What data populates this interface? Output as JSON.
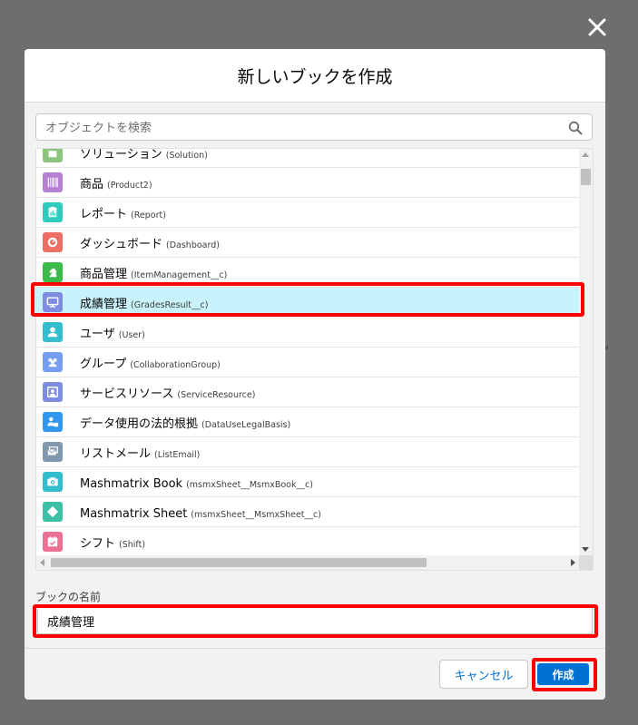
{
  "modal": {
    "title": "新しいブックを作成"
  },
  "search": {
    "placeholder": "オブジェクトを検索"
  },
  "objects": [
    {
      "label": "ソリューション",
      "api": "(Solution)",
      "icon": "solution-icon",
      "color": "#8dc47e"
    },
    {
      "label": "商品",
      "api": "(Product2)",
      "icon": "product-icon",
      "color": "#b781d3"
    },
    {
      "label": "レポート",
      "api": "(Report)",
      "icon": "report-icon",
      "color": "#2ecbbe"
    },
    {
      "label": "ダッシュボード",
      "api": "(Dashboard)",
      "icon": "dashboard-icon",
      "color": "#ef6e64"
    },
    {
      "label": "商品管理",
      "api": "(ItemManagement__c)",
      "icon": "chess-knight-icon",
      "color": "#3cba4c"
    },
    {
      "label": "成績管理",
      "api": "(GradesResult__c)",
      "icon": "monitor-icon",
      "color": "#7f8de1",
      "selected": true
    },
    {
      "label": "ユーザ",
      "api": "(User)",
      "icon": "user-icon",
      "color": "#34becd"
    },
    {
      "label": "グループ",
      "api": "(CollaborationGroup)",
      "icon": "group-icon",
      "color": "#779ef2"
    },
    {
      "label": "サービスリソース",
      "api": "(ServiceResource)",
      "icon": "service-resource-icon",
      "color": "#7f8de1"
    },
    {
      "label": "データ使用の法的根拠",
      "api": "(DataUseLegalBasis)",
      "icon": "legal-basis-icon",
      "color": "#3296ed"
    },
    {
      "label": "リストメール",
      "api": "(ListEmail)",
      "icon": "list-email-icon",
      "color": "#8199af"
    },
    {
      "label": "Mashmatrix Book",
      "api": "(msmxSheet__MsmxBook__c)",
      "icon": "camera-icon",
      "color": "#34becd"
    },
    {
      "label": "Mashmatrix Sheet",
      "api": "(msmxSheet__MsmxSheet__c)",
      "icon": "diamond-icon",
      "color": "#3cc1a6"
    },
    {
      "label": "シフト",
      "api": "(Shift)",
      "icon": "calendar-check-icon",
      "color": "#eb7092"
    }
  ],
  "book_name": {
    "label": "ブックの名前",
    "value": "成績管理"
  },
  "footer": {
    "cancel_label": "キャンセル",
    "create_label": "作成"
  }
}
